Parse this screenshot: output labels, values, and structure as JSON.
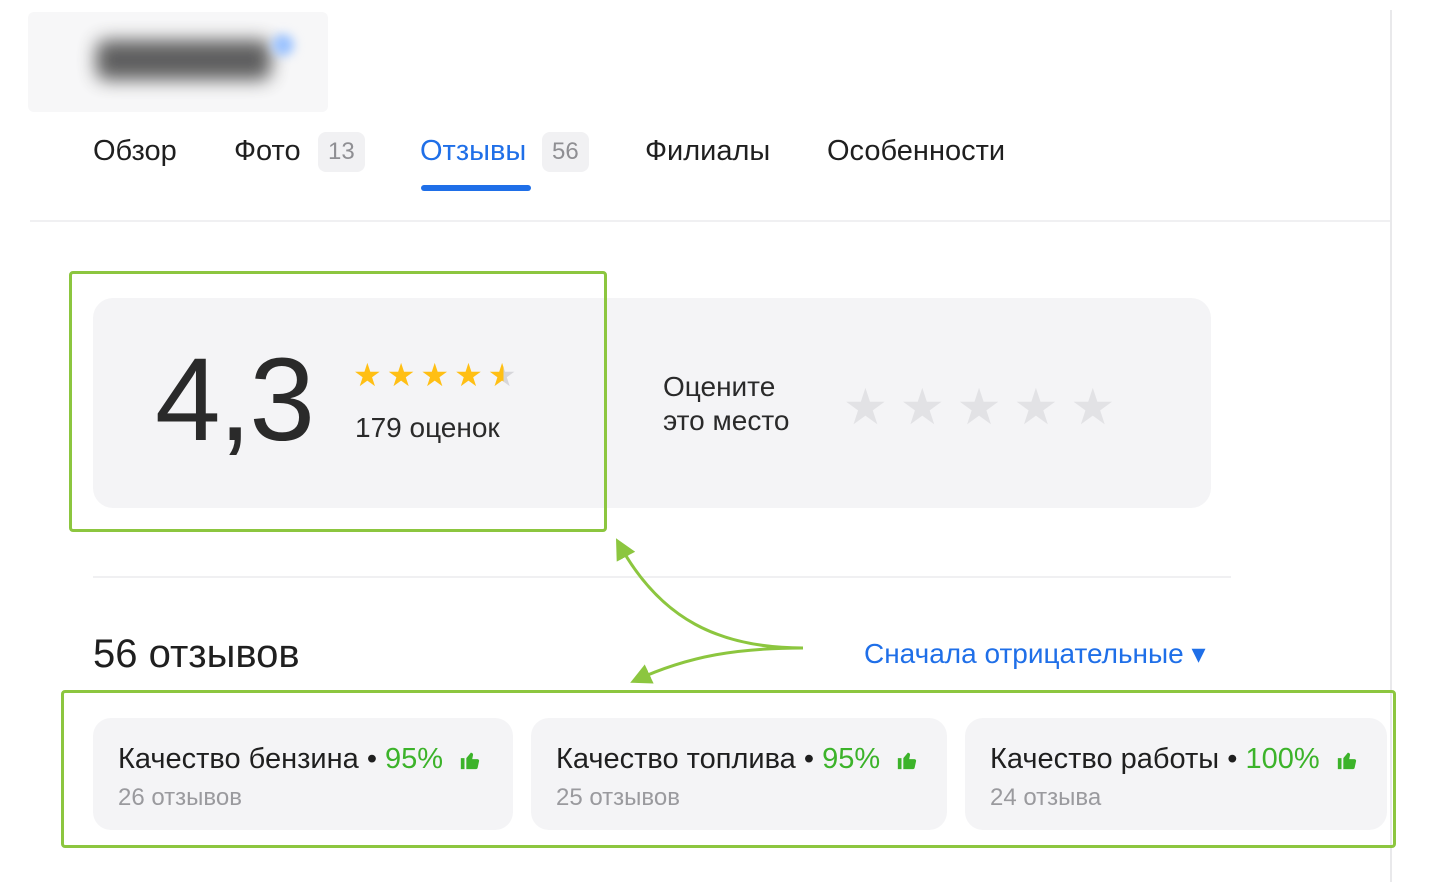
{
  "tabs": [
    {
      "label": "Обзор"
    },
    {
      "label": "Фото",
      "count": "13"
    },
    {
      "label": "Отзывы",
      "count": "56"
    },
    {
      "label": "Филиалы"
    },
    {
      "label": "Особенности"
    }
  ],
  "active_tab": "Отзывы",
  "rating": {
    "value": "4,3",
    "stars_filled": 4.3,
    "stars_total": 5,
    "count_label": "179 оценок"
  },
  "rate_place": {
    "line1": "Оцените",
    "line2": "это место",
    "stars_total": 5
  },
  "reviews": {
    "title": "56 отзывов",
    "sort_label": "Сначала отрицательные ▾"
  },
  "aspects": [
    {
      "name": "Качество бензина",
      "percent": "95%",
      "sub": "26 отзывов"
    },
    {
      "name": "Качество топлива",
      "percent": "95%",
      "sub": "25 отзывов"
    },
    {
      "name": "Качество работы",
      "percent": "100%",
      "sub": "24 отзыва"
    }
  ],
  "colors": {
    "accent": "#1f6fe8",
    "star": "#ffbf14",
    "positive": "#3cb32a",
    "highlight": "#8cc63f"
  },
  "icons": {
    "rating_star": "star-icon",
    "thumb": "thumbs-up-icon"
  }
}
